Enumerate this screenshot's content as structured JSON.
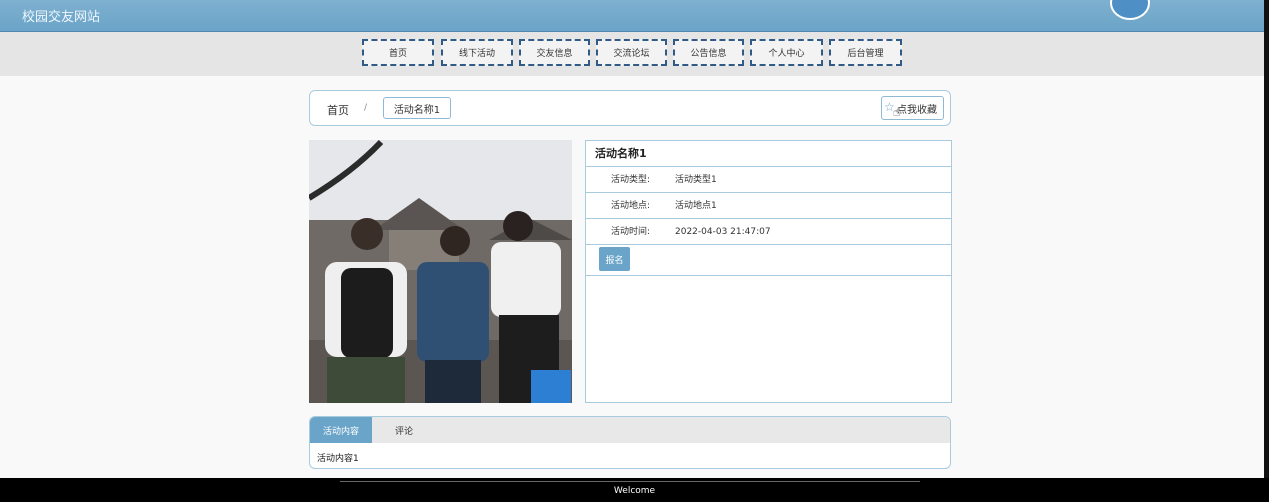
{
  "header": {
    "site_title": "校园交友网站"
  },
  "nav": {
    "items": [
      "首页",
      "线下活动",
      "交友信息",
      "交流论坛",
      "公告信息",
      "个人中心",
      "后台管理"
    ]
  },
  "breadcrumb": {
    "home": "首页",
    "separator": "/",
    "current": "活动名称1"
  },
  "favorite": {
    "label": "点我收藏",
    "icon": "star-icon"
  },
  "activity": {
    "title": "活动名称1",
    "rows": [
      {
        "label": "活动类型:",
        "value": "活动类型1"
      },
      {
        "label": "活动地点:",
        "value": "活动地点1"
      },
      {
        "label": "活动时间:",
        "value": "2022-04-03 21:47:07"
      }
    ],
    "signup_label": "报名"
  },
  "tabs": {
    "items": [
      "活动内容",
      "评论"
    ],
    "content": "活动内容1"
  },
  "footer": {
    "text": "Welcome"
  },
  "colors": {
    "accent": "#6aa4c8",
    "border": "#a9cbe0",
    "nav_border": "#2f5b86"
  }
}
